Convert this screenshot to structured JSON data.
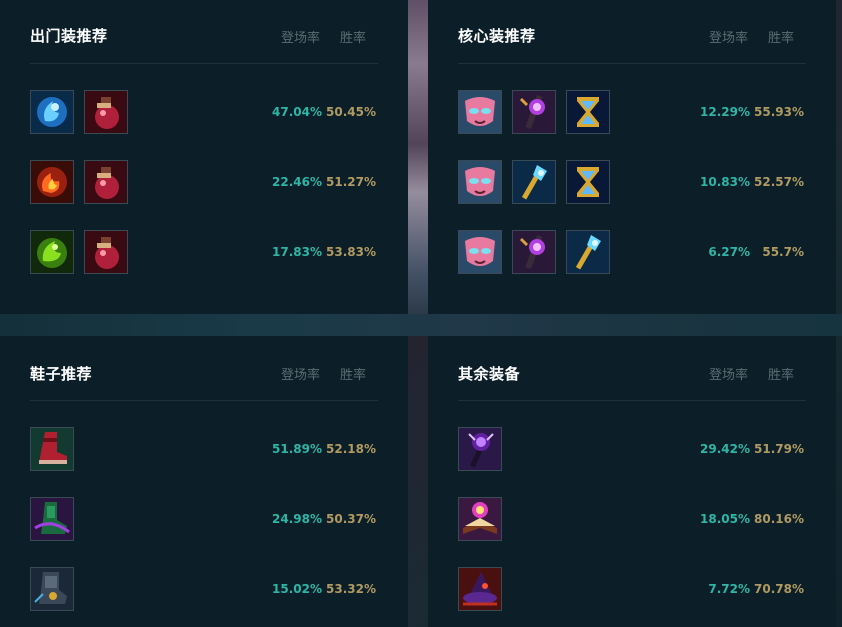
{
  "headers": {
    "pick_rate": "登场率",
    "win_rate": "胜率"
  },
  "panels": {
    "starter": {
      "title": "出门装推荐",
      "rows": [
        {
          "icons": [
            "blue-water-orb-icon",
            "red-potion-icon"
          ],
          "pick": "47.04%",
          "win": "50.45%"
        },
        {
          "icons": [
            "fire-orb-icon",
            "red-potion-icon"
          ],
          "pick": "22.46%",
          "win": "51.27%"
        },
        {
          "icons": [
            "green-orb-icon",
            "red-potion-icon"
          ],
          "pick": "17.83%",
          "win": "53.83%"
        }
      ]
    },
    "core": {
      "title": "核心装推荐",
      "rows": [
        {
          "icons": [
            "pink-mask-icon",
            "purple-staff-icon",
            "hourglass-icon"
          ],
          "pick": "12.29%",
          "win": "55.93%"
        },
        {
          "icons": [
            "pink-mask-icon",
            "blue-scepter-icon",
            "hourglass-icon"
          ],
          "pick": "10.83%",
          "win": "52.57%"
        },
        {
          "icons": [
            "pink-mask-icon",
            "purple-staff-icon",
            "blue-scepter-icon"
          ],
          "pick": "6.27%",
          "win": "55.7%"
        }
      ]
    },
    "boots": {
      "title": "鞋子推荐",
      "rows": [
        {
          "icons": [
            "red-boots-icon"
          ],
          "pick": "51.89%",
          "win": "52.18%"
        },
        {
          "icons": [
            "green-boots-icon"
          ],
          "pick": "24.98%",
          "win": "50.37%"
        },
        {
          "icons": [
            "armored-boots-icon"
          ],
          "pick": "15.02%",
          "win": "53.32%"
        }
      ]
    },
    "other": {
      "title": "其余装备",
      "rows": [
        {
          "icons": [
            "void-staff-icon"
          ],
          "pick": "29.42%",
          "win": "51.79%"
        },
        {
          "icons": [
            "spellbook-icon"
          ],
          "pick": "18.05%",
          "win": "80.16%"
        },
        {
          "icons": [
            "witch-hat-icon"
          ],
          "pick": "7.72%",
          "win": "70.78%"
        }
      ]
    }
  },
  "colors": {
    "panel_bg": "#0c1f28",
    "pick_rate": "#2fb5a5",
    "win_rate": "#b09a62",
    "header_muted": "#5c6b72"
  }
}
